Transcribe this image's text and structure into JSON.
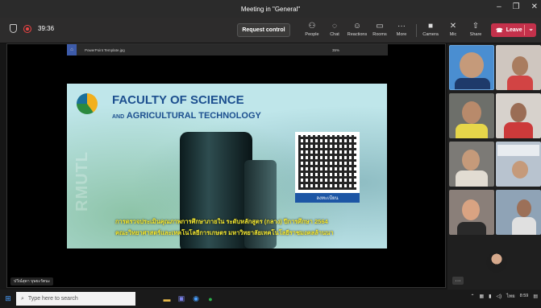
{
  "window": {
    "title": "Meeting in \"General\""
  },
  "toolbar": {
    "timer": "39:36",
    "request_control": "Request control",
    "tools": [
      {
        "label": "People",
        "icon": "people-icon"
      },
      {
        "label": "Chat",
        "icon": "chat-icon"
      },
      {
        "label": "Reactions",
        "icon": "reactions-icon"
      },
      {
        "label": "Rooms",
        "icon": "rooms-icon"
      },
      {
        "label": "More",
        "icon": "more-icon"
      },
      {
        "label": "Camera",
        "icon": "camera-icon"
      },
      {
        "label": "Mic",
        "icon": "mic-off-icon"
      },
      {
        "label": "Share",
        "icon": "share-icon"
      }
    ],
    "leave": "Leave"
  },
  "viewer": {
    "filename": "PowerPoint Template.jpg",
    "zoom": "35%"
  },
  "slide": {
    "title_line1": "FACULTY OF SCIENCE",
    "title_line2_prefix": "AND",
    "title_line2": "AGRICULTURAL TECHNOLOGY",
    "vertical_text": "RMUTL",
    "qr_label": "ลงทะเบียน",
    "thai_line1": "การตรวจประเมินคุณภาพการศึกษาภายใน ระดับหลักสูตร (กลาง) ปีการศึกษา 2564",
    "thai_line2": "คณะวิทยาศาสตร์และเทคโนโลยีการเกษตร มหาวิทยาลัยเทคโนโลยีราชมงคลล้านนา"
  },
  "presenter_name": "ปวีณ์สุดา บุษยะรัตนะ",
  "taskbar": {
    "search_placeholder": "Type here to search",
    "time": "8:59",
    "lang": "ไทย"
  },
  "colors": {
    "leave": "#c4314b",
    "title_blue": "#1c4f8f",
    "thai_yellow": "#f4e832",
    "qr_label_bg": "#1d56a5"
  }
}
